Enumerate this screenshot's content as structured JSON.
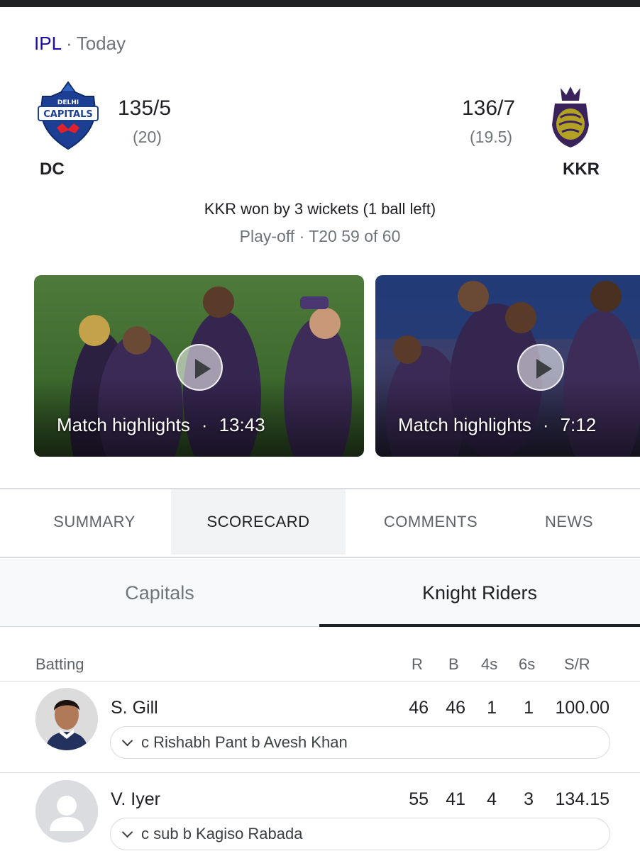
{
  "header": {
    "league": "IPL",
    "separator": "·",
    "day": "Today"
  },
  "match": {
    "home": {
      "abbr": "DC",
      "logo_text_top": "DELHI",
      "logo_text_main": "CAPITALS",
      "score": "135/5",
      "overs": "(20)"
    },
    "away": {
      "abbr": "KKR",
      "score": "136/7",
      "overs": "(19.5)"
    },
    "result": "KKR won by 3 wickets (1 ball left)",
    "stage": "Play-off · T20 59 of 60"
  },
  "videos": [
    {
      "title": "Match highlights",
      "sep": "·",
      "duration": "13:43"
    },
    {
      "title": "Match highlights",
      "sep": "·",
      "duration": "7:12"
    }
  ],
  "tabs": [
    {
      "label": "SUMMARY",
      "active": false
    },
    {
      "label": "SCORECARD",
      "active": true
    },
    {
      "label": "COMMENTS",
      "active": false
    },
    {
      "label": "NEWS",
      "active": false
    }
  ],
  "team_tabs": [
    {
      "label": "Capitals",
      "active": false
    },
    {
      "label": "Knight Riders",
      "active": true
    }
  ],
  "batting": {
    "headers": {
      "section": "Batting",
      "r": "R",
      "b": "B",
      "fours": "4s",
      "sixes": "6s",
      "sr": "S/R"
    },
    "rows": [
      {
        "name": "S. Gill",
        "r": "46",
        "b": "46",
        "fours": "1",
        "sixes": "1",
        "sr": "100.00",
        "dismissal": "c Rishabh Pant b Avesh Khan",
        "avatar": "player-photo"
      },
      {
        "name": "V. Iyer",
        "r": "55",
        "b": "41",
        "fours": "4",
        "sixes": "3",
        "sr": "134.15",
        "dismissal": "c sub b Kagiso Rabada",
        "avatar": "placeholder"
      }
    ]
  },
  "colors": {
    "dc_blue": "#1c3f94",
    "dc_red": "#e2202c",
    "kkr_purple": "#3a225d",
    "kkr_gold": "#b3a123",
    "link": "#1a0dab"
  }
}
